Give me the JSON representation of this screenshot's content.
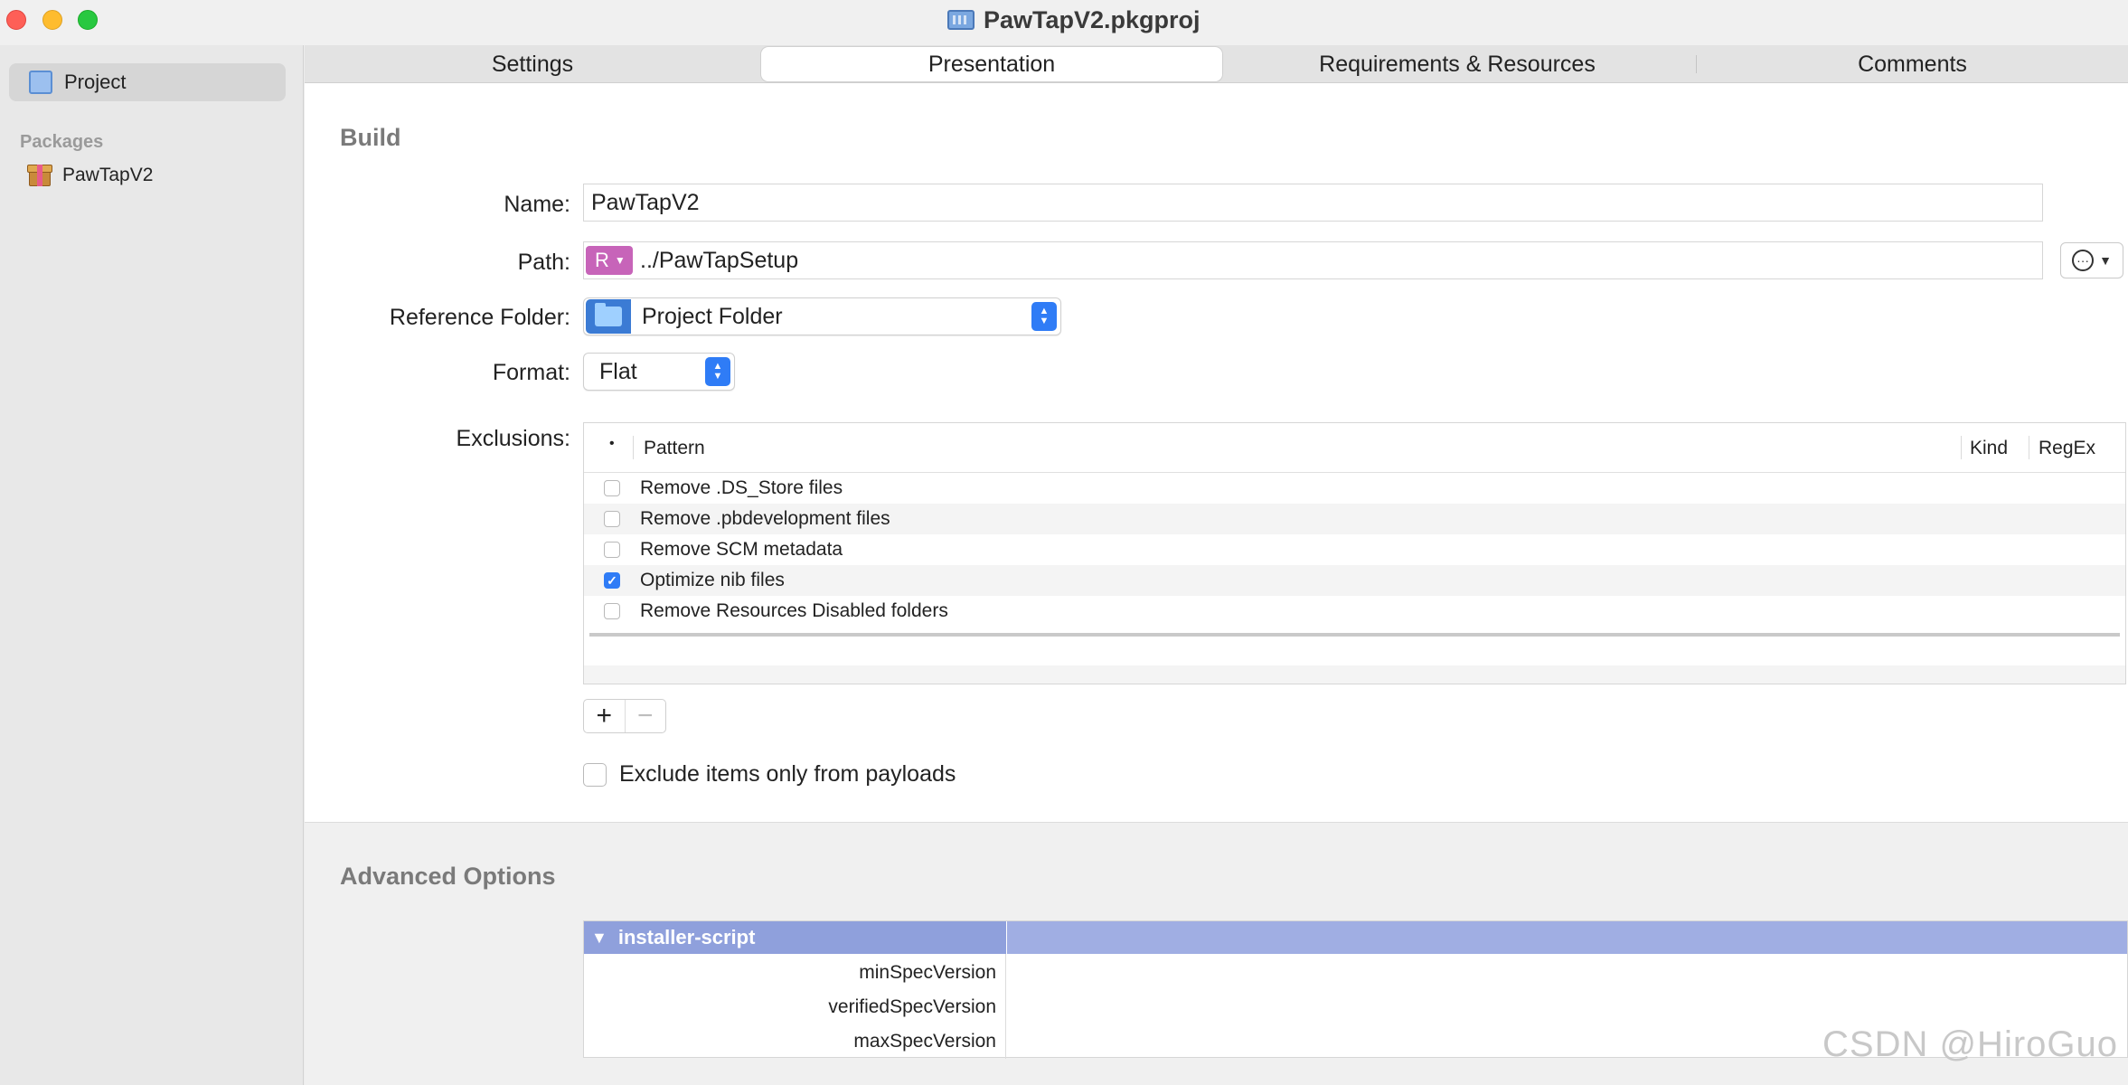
{
  "window": {
    "title": "PawTapV2.pkgproj"
  },
  "sidebar": {
    "project_label": "Project",
    "section_label": "Packages",
    "package_label": "PawTapV2"
  },
  "tabs": [
    {
      "label": "Settings",
      "selected": false
    },
    {
      "label": "Presentation",
      "selected": true
    },
    {
      "label": "Requirements & Resources",
      "selected": false
    },
    {
      "label": "Comments",
      "selected": false
    }
  ],
  "build": {
    "title": "Build",
    "name_label": "Name:",
    "name_value": "PawTapV2",
    "path_label": "Path:",
    "path_badge": "R",
    "path_value": "../PawTapSetup",
    "ref_folder_label": "Reference Folder:",
    "ref_folder_value": "Project Folder",
    "format_label": "Format:",
    "format_value": "Flat",
    "exclusions_label": "Exclusions:",
    "exclusions_table": {
      "headers": {
        "dot": "•",
        "pattern": "Pattern",
        "kind": "Kind",
        "regex": "RegEx"
      },
      "rows": [
        {
          "label": "Remove .DS_Store files",
          "checked": false
        },
        {
          "label": "Remove .pbdevelopment files",
          "checked": false
        },
        {
          "label": "Remove SCM metadata",
          "checked": false
        },
        {
          "label": "Optimize nib files",
          "checked": true
        },
        {
          "label": "Remove Resources Disabled folders",
          "checked": false
        }
      ]
    },
    "add_symbol": "+",
    "remove_symbol": "−",
    "exclude_payloads_label": "Exclude items only from payloads",
    "exclude_payloads_checked": false
  },
  "advanced": {
    "title": "Advanced Options",
    "group_label": "installer-script",
    "rows": [
      "minSpecVersion",
      "verifiedSpecVersion",
      "maxSpecVersion"
    ]
  },
  "watermark": "CSDN @HiroGuo",
  "colors": {
    "accent": "#2f7cf6",
    "path_badge": "#c764b9",
    "adv_header": "#a0aee3"
  }
}
